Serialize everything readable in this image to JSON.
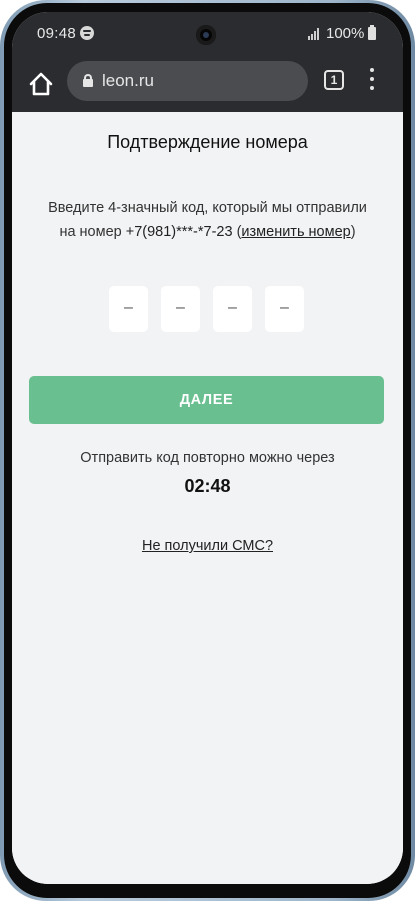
{
  "status_bar": {
    "time": "09:48",
    "battery": "100%",
    "icons": [
      "spotify-icon",
      "signal-icon",
      "battery-icon"
    ]
  },
  "browser": {
    "url": "leon.ru",
    "tab_count": "1",
    "icons": [
      "home-icon",
      "lock-icon",
      "tabs-icon",
      "more-vert-icon"
    ]
  },
  "page": {
    "title": "Подтверждение номера",
    "instruction_line1": "Введите 4-значный код, который мы отправили",
    "instruction_prefix": "на номер ",
    "phone_masked": "+7(981)***-*7-23",
    "change_open": " (",
    "change_link": "изменить номер",
    "change_close": ")",
    "code_digits": [
      "–",
      "–",
      "–",
      "–"
    ],
    "next_button": "ДАЛЕЕ",
    "resend_text": "Отправить код повторно можно через",
    "timer": "02:48",
    "no_sms_link": "Не получили СМС?"
  },
  "colors": {
    "accent": "#6abf90",
    "background": "#f2f3f5",
    "browser_bar": "#2a2c2f"
  }
}
